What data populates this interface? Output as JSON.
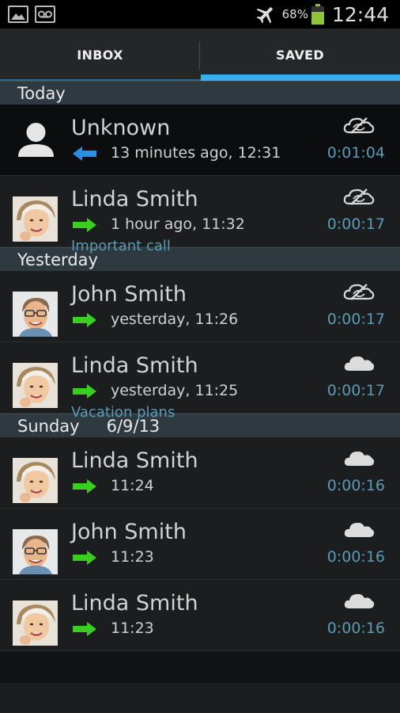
{
  "status_bar": {
    "battery_percent": "68%",
    "time": "12:44",
    "icons": [
      "gallery-icon",
      "voicemail-icon",
      "airplane-mode-icon",
      "battery-icon"
    ]
  },
  "tabs": [
    {
      "label": "INBOX",
      "selected": false
    },
    {
      "label": "SAVED",
      "selected": true
    }
  ],
  "accent_color": "#35b2e5",
  "sections": [
    {
      "label": "Today",
      "date": "",
      "calls": [
        {
          "name": "Unknown",
          "direction": "incoming",
          "when": "13 minutes ago, 12:31",
          "note": "",
          "duration": "0:01:04",
          "cloud": "cloud-sync-crossed-icon",
          "avatar": "unknown"
        },
        {
          "name": "Linda Smith",
          "direction": "outgoing",
          "when": "1 hour ago, 11:32",
          "note": "Important call",
          "duration": "0:00:17",
          "cloud": "cloud-sync-crossed-icon",
          "avatar": "female"
        }
      ]
    },
    {
      "label": "Yesterday",
      "date": "",
      "calls": [
        {
          "name": "John Smith",
          "direction": "outgoing",
          "when": "yesterday, 11:26",
          "note": "",
          "duration": "0:00:17",
          "cloud": "cloud-sync-crossed-icon",
          "avatar": "male"
        },
        {
          "name": "Linda Smith",
          "direction": "outgoing",
          "when": "yesterday, 11:25",
          "note": "Vacation plans",
          "duration": "0:00:17",
          "cloud": "cloud-icon",
          "avatar": "female"
        }
      ]
    },
    {
      "label": "Sunday",
      "date": "6/9/13",
      "calls": [
        {
          "name": "Linda Smith",
          "direction": "outgoing",
          "when": "11:24",
          "note": "",
          "duration": "0:00:16",
          "cloud": "cloud-icon",
          "avatar": "female"
        },
        {
          "name": "John Smith",
          "direction": "outgoing",
          "when": "11:23",
          "note": "",
          "duration": "0:00:16",
          "cloud": "cloud-icon",
          "avatar": "male"
        },
        {
          "name": "Linda Smith",
          "direction": "outgoing",
          "when": "11:23",
          "note": "",
          "duration": "0:00:16",
          "cloud": "cloud-icon",
          "avatar": "female"
        }
      ]
    }
  ]
}
